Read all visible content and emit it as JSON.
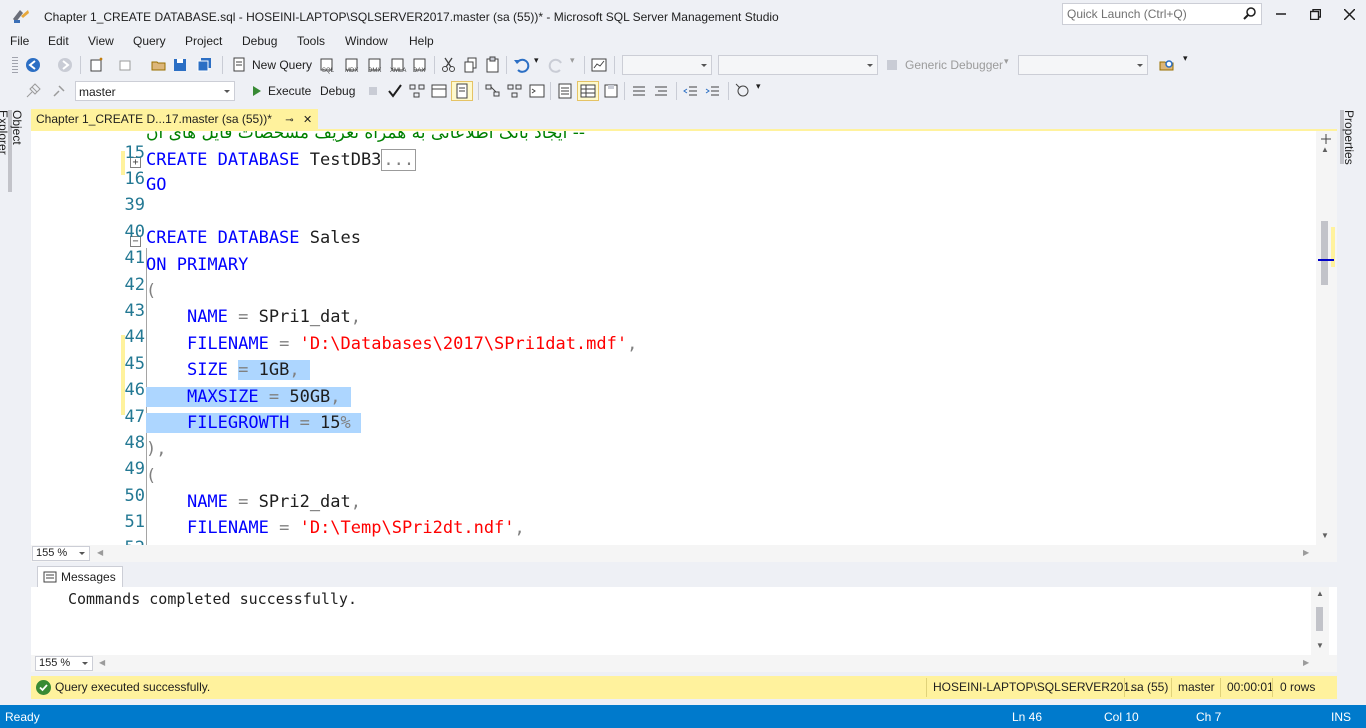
{
  "window": {
    "title": "Chapter 1_CREATE DATABASE.sql - HOSEINI-LAPTOP\\SQLSERVER2017.master (sa (55))* - Microsoft SQL Server Management Studio",
    "quick_launch_placeholder": "Quick Launch (Ctrl+Q)"
  },
  "menu": [
    "File",
    "Edit",
    "View",
    "Query",
    "Project",
    "Debug",
    "Tools",
    "Window",
    "Help"
  ],
  "toolbar1": {
    "new_query": "New Query",
    "debugger": "Generic Debugger"
  },
  "toolbar2": {
    "database": "master",
    "execute": "Execute",
    "debug": "Debug"
  },
  "side_panels": {
    "left": "Object Explorer",
    "right": "Properties"
  },
  "document_tab": {
    "label": "Chapter 1_CREATE D...17.master (sa (55))*"
  },
  "editor": {
    "lines": [
      {
        "num": "15",
        "text": "-- ایجاد بانک اطلاعاتی به همراه تعریف مشخصات فایل های آن"
      },
      {
        "num": "16",
        "text": "CREATE DATABASE TestDB3",
        "collapsed": "..."
      },
      {
        "num": "39",
        "text": "GO"
      },
      {
        "num": "40",
        "text": ""
      },
      {
        "num": "41",
        "text": "CREATE DATABASE Sales"
      },
      {
        "num": "42",
        "text": "ON PRIMARY"
      },
      {
        "num": "43",
        "text": "("
      },
      {
        "num": "44",
        "text": "NAME = SPri1_dat,"
      },
      {
        "num": "45",
        "text": "FILENAME = 'D:\\Databases\\2017\\SPri1dat.mdf',"
      },
      {
        "num": "46",
        "text": "SIZE = 1GB,"
      },
      {
        "num": "47",
        "text": "MAXSIZE = 50GB,"
      },
      {
        "num": "48",
        "text": "FILEGROWTH = 15%"
      },
      {
        "num": "49",
        "text": "),"
      },
      {
        "num": "50",
        "text": "("
      },
      {
        "num": "51",
        "text": "NAME = SPri2_dat,"
      },
      {
        "num": "52",
        "text": "FILENAME = 'D:\\Temp\\SPri2dt.ndf',"
      }
    ],
    "zoom": "155 %"
  },
  "results": {
    "tab_label": "Messages",
    "message": "Commands completed successfully.",
    "zoom": "155 %"
  },
  "query_status": {
    "text": "Query executed successfully.",
    "server": "HOSEINI-LAPTOP\\SQLSERVER201...",
    "user": "sa (55)",
    "database": "master",
    "elapsed": "00:00:01",
    "rows": "0 rows"
  },
  "status_bar": {
    "state": "Ready",
    "ln": "Ln 46",
    "col": "Col 10",
    "ch": "Ch 7",
    "mode": "INS"
  },
  "colors": {
    "accent": "#007acc",
    "tab_yellow": "#fff29d",
    "keyword": "#0000ff",
    "string": "#ff0000",
    "comment": "#008000",
    "line_number": "#237893",
    "selection": "#add6ff"
  }
}
